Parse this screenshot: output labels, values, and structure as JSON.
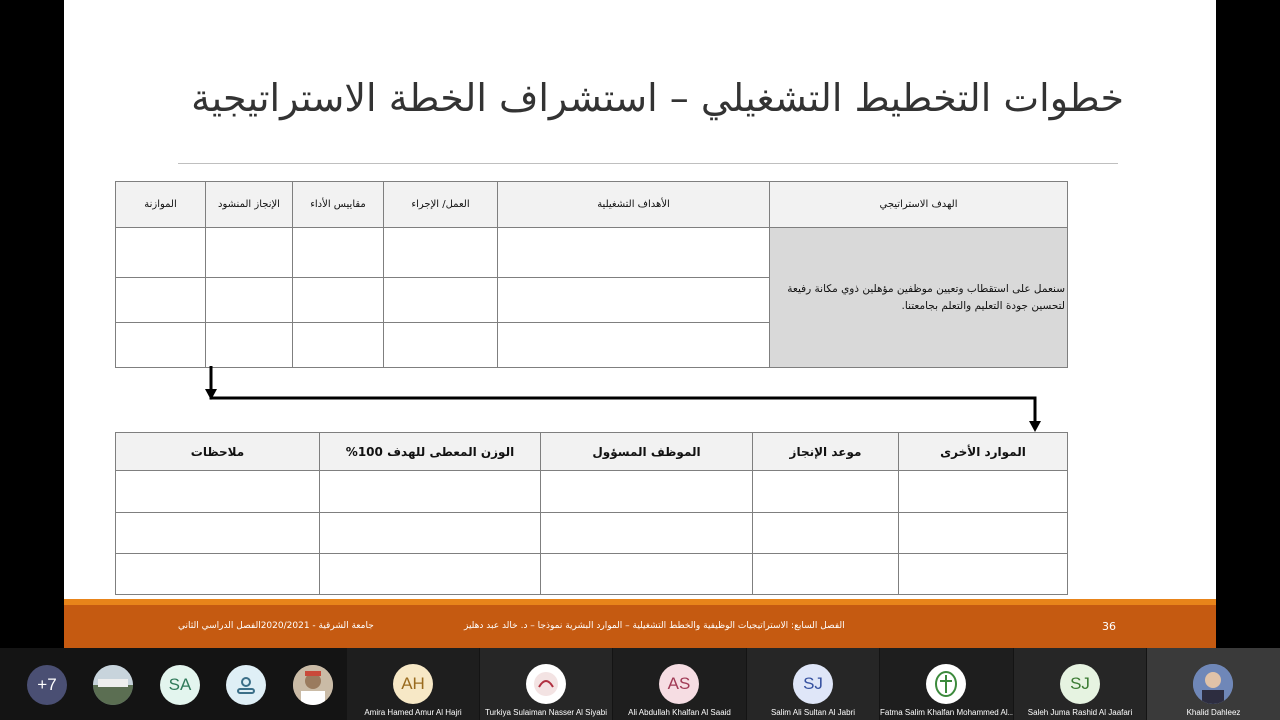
{
  "slide": {
    "title": "خطوات التخطيط التشغيلي – استشراف الخطة الاستراتيجية",
    "plan_table": {
      "headers": [
        "الهدف الاستراتيجي",
        "الأهداف التشغيلية",
        "العمل/ الإجراء",
        "مقاييس الأداء",
        "الإنجاز المنشود",
        "الموازنة"
      ],
      "goal_text": "سنعمل على استقطاب وتعيين موظفين مؤهلين ذوي مكانة رفيعة لتحسين جودة التعليم والتعلم بجامعتنا."
    },
    "followup_table": {
      "headers": [
        "الموارد الأخرى",
        "موعد الإنجاز",
        "الموظف المسؤول",
        "الوزن المعطى للهدف 100%",
        "ملاحظات"
      ]
    },
    "footer": {
      "page_number": "36",
      "chapter": "الفصل السابع: الاستراتيجيات الوظيفية والخطط التشغيلية – الموارد البشرية نموذجا – د. خالد عبد دهليز",
      "university": "جامعة الشرقية - 2020/2021الفصل الدراسي الثاني"
    }
  },
  "meeting": {
    "more_count": "+7",
    "avatars": [
      {
        "initials": "SA",
        "color": "#e3f5ee"
      },
      {
        "initials": "",
        "color": "#e3f5ee"
      }
    ],
    "participants": [
      {
        "name": "Amira Hamed Amur Al Hajri",
        "initials": "AH",
        "color": "#f7e8c6"
      },
      {
        "name": "Turkiya Sulaiman Nasser Al Siyabi",
        "initials": "",
        "color": "#ffffff"
      },
      {
        "name": "Ali Abdullah Khalfan Al Saaid",
        "initials": "AS",
        "color": "#f6dde3"
      },
      {
        "name": "Salim Ali Sultan Al Jabri",
        "initials": "SJ",
        "color": "#dfe6f8"
      },
      {
        "name": "Fatma Salim Khalfan Mohammed Al...",
        "initials": "",
        "color": "#ffffff"
      },
      {
        "name": "Saleh Juma Rashid Al Jaafari",
        "initials": "SJ",
        "color": "#e6f3e1"
      },
      {
        "name": "Khalid Dahleez",
        "initials": "",
        "color": "#8aa0c8"
      }
    ]
  }
}
